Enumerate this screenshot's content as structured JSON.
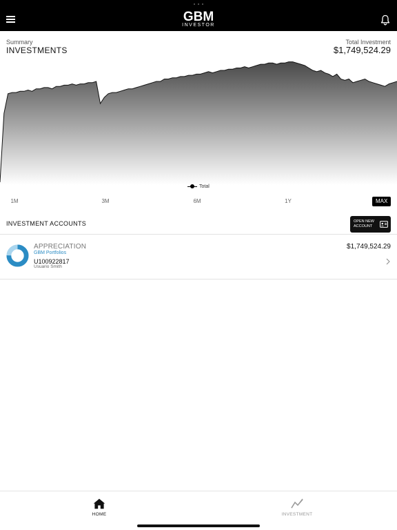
{
  "header": {
    "logo_main": "GBM",
    "logo_sub": "INVESTOR",
    "menu_icon": "hamburger-menu-icon",
    "notification_icon": "bell-icon"
  },
  "summary": {
    "label": "Summary",
    "title": "INVESTMENTS",
    "total_label": "Total Investment",
    "total_value": "$1,749,524.29"
  },
  "chart_data": {
    "type": "area",
    "title": "",
    "xlabel": "",
    "ylabel": "",
    "legend": [
      "Total"
    ],
    "legend_placement": "bottom-center",
    "grid": false,
    "series": [
      {
        "name": "Total",
        "color": "#000000",
        "values": [
          0.0,
          0.56,
          0.72,
          0.73,
          0.73,
          0.74,
          0.74,
          0.75,
          0.74,
          0.76,
          0.76,
          0.77,
          0.77,
          0.76,
          0.78,
          0.78,
          0.79,
          0.79,
          0.8,
          0.79,
          0.8,
          0.8,
          0.81,
          0.81,
          0.82,
          0.64,
          0.69,
          0.72,
          0.73,
          0.73,
          0.74,
          0.75,
          0.76,
          0.76,
          0.77,
          0.78,
          0.79,
          0.8,
          0.81,
          0.82,
          0.82,
          0.84,
          0.84,
          0.85,
          0.85,
          0.86,
          0.86,
          0.87,
          0.87,
          0.88,
          0.88,
          0.89,
          0.9,
          0.89,
          0.9,
          0.91,
          0.91,
          0.92,
          0.92,
          0.93,
          0.93,
          0.94,
          0.93,
          0.94,
          0.95,
          0.96,
          0.96,
          0.97,
          0.97,
          0.96,
          0.97,
          0.97,
          0.98,
          0.98,
          0.97,
          0.96,
          0.95,
          0.93,
          0.91,
          0.9,
          0.91,
          0.89,
          0.88,
          0.86,
          0.88,
          0.84,
          0.83,
          0.84,
          0.81,
          0.82,
          0.83,
          0.84,
          0.82,
          0.81,
          0.8,
          0.79,
          0.78,
          0.8,
          0.81,
          0.82
        ]
      }
    ],
    "ranges": [
      "1M",
      "3M",
      "6M",
      "1Y",
      "MAX"
    ],
    "selected_range": "MAX"
  },
  "accounts_section": {
    "title": "INVESTMENT ACCOUNTS",
    "open_button_label": "OPEN NEW ACCOUNT",
    "open_button_icon": "id-card-icon"
  },
  "accounts": [
    {
      "name": "APPRECIATION",
      "provider": "GBM Portfolios",
      "number": "U100922817",
      "owner": "Usuario Smith",
      "value": "$1,749,524.29",
      "donut_colors": [
        "#2b8cc4",
        "#a9d5ee"
      ],
      "donut_share": 0.75
    }
  ],
  "bottom_nav": {
    "items": [
      {
        "label": "HOME",
        "icon": "home-icon",
        "active": true
      },
      {
        "label": "INVESTMENT",
        "icon": "chart-line-icon",
        "active": false
      }
    ]
  }
}
